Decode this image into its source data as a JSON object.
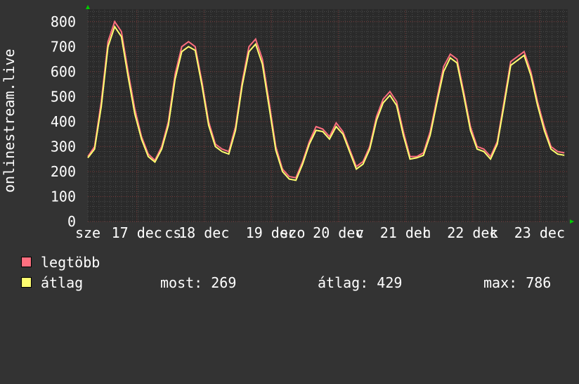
{
  "colors": {
    "background": "#333333",
    "plot_background": "#2a2a2a",
    "grid_minor": "#4a4a4a",
    "grid_major": "#7a3a3a",
    "axis_arrow": "#00cc00",
    "series_max": "#ff6f7f",
    "series_avg": "#ffff70"
  },
  "legend": {
    "max_label": "legtöbb",
    "avg_label": "átlag",
    "now_stat": "most: 269",
    "avg_stat": "átlag: 429",
    "max_stat": "max: 786"
  },
  "chart_data": {
    "type": "line",
    "ylabel": "onlinestream.live",
    "ylim": [
      0,
      850
    ],
    "yticks": [
      0,
      100,
      200,
      300,
      400,
      500,
      600,
      700,
      800
    ],
    "xlim": [
      0,
      7.15
    ],
    "x_tick_labels": [
      {
        "x": 0,
        "label": "sze"
      },
      {
        "x": 0.73,
        "label": "17 dec"
      },
      {
        "x": 1.27,
        "label": "cs"
      },
      {
        "x": 1.73,
        "label": "18 dec"
      },
      {
        "x": 2.73,
        "label": "19 dec"
      },
      {
        "x": 3.05,
        "label": "szo"
      },
      {
        "x": 3.73,
        "label": "20 dec"
      },
      {
        "x": 4.05,
        "label": "v"
      },
      {
        "x": 4.73,
        "label": "21 dec"
      },
      {
        "x": 5.05,
        "label": "h"
      },
      {
        "x": 5.73,
        "label": "22 dec"
      },
      {
        "x": 6.05,
        "label": "k"
      },
      {
        "x": 6.73,
        "label": "23 dec"
      }
    ],
    "series": [
      {
        "name": "legtöbb",
        "x": [
          0,
          0.1,
          0.2,
          0.3,
          0.4,
          0.5,
          0.6,
          0.7,
          0.8,
          0.9,
          1.0,
          1.1,
          1.2,
          1.3,
          1.4,
          1.5,
          1.6,
          1.7,
          1.8,
          1.9,
          2.0,
          2.1,
          2.2,
          2.3,
          2.4,
          2.5,
          2.6,
          2.7,
          2.8,
          2.9,
          3.0,
          3.1,
          3.2,
          3.3,
          3.4,
          3.5,
          3.6,
          3.7,
          3.8,
          3.9,
          4.0,
          4.1,
          4.2,
          4.3,
          4.4,
          4.5,
          4.6,
          4.7,
          4.8,
          4.9,
          5.0,
          5.1,
          5.2,
          5.3,
          5.4,
          5.5,
          5.6,
          5.7,
          5.8,
          5.9,
          6.0,
          6.1,
          6.2,
          6.3,
          6.4,
          6.5,
          6.6,
          6.7,
          6.8,
          6.9,
          7.0,
          7.1
        ],
        "values": [
          260,
          300,
          480,
          720,
          800,
          760,
          600,
          450,
          340,
          270,
          245,
          300,
          400,
          590,
          700,
          720,
          700,
          560,
          400,
          310,
          290,
          280,
          380,
          560,
          700,
          730,
          650,
          480,
          300,
          210,
          180,
          175,
          240,
          320,
          380,
          370,
          340,
          395,
          360,
          290,
          220,
          240,
          300,
          420,
          490,
          520,
          480,
          360,
          260,
          260,
          275,
          360,
          490,
          620,
          670,
          650,
          520,
          380,
          300,
          290,
          260,
          320,
          480,
          640,
          660,
          680,
          600,
          480,
          380,
          300,
          280,
          275
        ]
      },
      {
        "name": "átlag",
        "x": [
          0,
          0.1,
          0.2,
          0.3,
          0.4,
          0.5,
          0.6,
          0.7,
          0.8,
          0.9,
          1.0,
          1.1,
          1.2,
          1.3,
          1.4,
          1.5,
          1.6,
          1.7,
          1.8,
          1.9,
          2.0,
          2.1,
          2.2,
          2.3,
          2.4,
          2.5,
          2.6,
          2.7,
          2.8,
          2.9,
          3.0,
          3.1,
          3.2,
          3.3,
          3.4,
          3.5,
          3.6,
          3.7,
          3.8,
          3.9,
          4.0,
          4.1,
          4.2,
          4.3,
          4.4,
          4.5,
          4.6,
          4.7,
          4.8,
          4.9,
          5.0,
          5.1,
          5.2,
          5.3,
          5.4,
          5.5,
          5.6,
          5.7,
          5.8,
          5.9,
          6.0,
          6.1,
          6.2,
          6.3,
          6.4,
          6.5,
          6.6,
          6.7,
          6.8,
          6.9,
          7.0,
          7.1
        ],
        "values": [
          255,
          290,
          460,
          700,
          780,
          740,
          580,
          430,
          330,
          260,
          238,
          290,
          385,
          570,
          680,
          700,
          685,
          545,
          385,
          300,
          280,
          270,
          365,
          545,
          680,
          710,
          630,
          460,
          285,
          200,
          170,
          165,
          230,
          310,
          365,
          360,
          330,
          380,
          350,
          280,
          210,
          230,
          290,
          405,
          475,
          505,
          465,
          345,
          250,
          255,
          265,
          345,
          475,
          600,
          655,
          635,
          505,
          365,
          290,
          280,
          250,
          310,
          465,
          625,
          645,
          665,
          585,
          465,
          365,
          290,
          270,
          265
        ]
      }
    ]
  }
}
